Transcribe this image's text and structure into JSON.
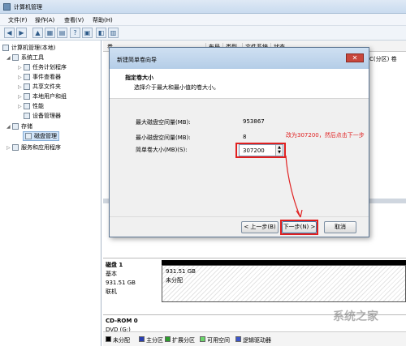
{
  "window": {
    "title": "计算机管理"
  },
  "menu": [
    "文件(F)",
    "操作(A)",
    "查看(V)",
    "帮助(H)"
  ],
  "tree": {
    "root": "计算机管理(本地)",
    "system_tools": "系统工具",
    "task_scheduler": "任务计划程序",
    "event_viewer": "事件查看器",
    "shared_folders": "共享文件夹",
    "local_users": "本地用户和组",
    "performance": "性能",
    "device_manager": "设备管理器",
    "storage": "存储",
    "disk_management": "磁盘管理",
    "services_apps": "服务和应用程序"
  },
  "columns": [
    "卷",
    "布局",
    "类型",
    "文件系统",
    "状态"
  ],
  "row_text": "C(分区) 卷",
  "disks": [
    {
      "name": "磁盘 1",
      "type": "基本",
      "size": "931.51 GB",
      "status": "联机",
      "part_size": "931.51 GB",
      "part_status": "未分配"
    },
    {
      "name": "CD-ROM 0",
      "type": "DVD (G:)",
      "status": "",
      "part_size": "",
      "part_status": ""
    }
  ],
  "legend": [
    "未分配",
    "主分区",
    "扩展分区",
    "可用空间",
    "逻辑驱动器"
  ],
  "legend_colors": [
    "#000000",
    "#2a3fb0",
    "#2e9d2e",
    "#6bd46b",
    "#3d56c8"
  ],
  "wizard": {
    "title": "新建简单卷向导",
    "close": "✕",
    "heading": "指定卷大小",
    "subheading": "选择介于最大和最小值的卷大小。",
    "max_label": "最大磁盘空间量(MB):",
    "max_value": "953867",
    "min_label": "最小磁盘空间量(MB):",
    "min_value": "8",
    "size_label": "简单卷大小(MB)(S):",
    "size_value": "307200",
    "back": "< 上一步(B)",
    "next": "下一步(N) >",
    "cancel": "取消"
  },
  "annotation": "改为307200，然后点击下一步",
  "watermark": "系统之家"
}
